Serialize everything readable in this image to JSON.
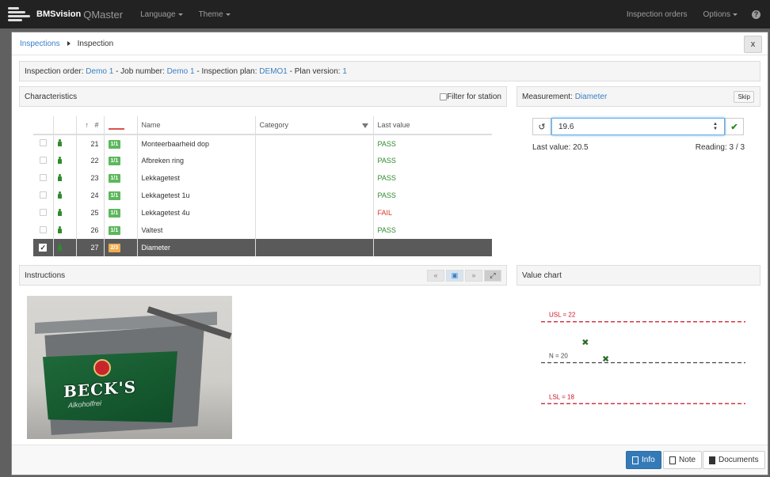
{
  "navbar": {
    "brand_name": "BMSvision",
    "brand_sub": "QMaster",
    "language": "Language",
    "theme": "Theme",
    "inspection_orders": "Inspection orders",
    "options": "Options",
    "help": "?"
  },
  "header": {
    "breadcrumb_root": "Inspections",
    "breadcrumb_current": "Inspection",
    "close": "x"
  },
  "order": {
    "order_label": "Inspection order:",
    "order_value": "Demo 1",
    "job_label": " - Job number:",
    "job_value": "Demo 1",
    "plan_label": " - Inspection plan:",
    "plan_value": "DEMO1",
    "version_label": " - Plan version:",
    "version_value": "1"
  },
  "characteristics": {
    "title": "Characteristics",
    "filter_label": "Filter for station",
    "columns": {
      "sort": "↑",
      "num": "#",
      "name": "Name",
      "category": "Category",
      "last_value": "Last value"
    },
    "rows": [
      {
        "num": "21",
        "badge": "1/1",
        "name": "Monteerbaarheid dop",
        "category": "",
        "last_value": "PASS"
      },
      {
        "num": "22",
        "badge": "1/1",
        "name": "Afbreken ring",
        "category": "",
        "last_value": "PASS"
      },
      {
        "num": "23",
        "badge": "1/1",
        "name": "Lekkagetest",
        "category": "",
        "last_value": "PASS"
      },
      {
        "num": "24",
        "badge": "1/1",
        "name": "Lekkagetest 1u",
        "category": "",
        "last_value": "PASS"
      },
      {
        "num": "25",
        "badge": "1/1",
        "name": "Lekkagetest 4u",
        "category": "",
        "last_value": "FAIL"
      },
      {
        "num": "26",
        "badge": "1/1",
        "name": "Valtest",
        "category": "",
        "last_value": "PASS"
      },
      {
        "num": "27",
        "badge": "2/3",
        "name": "Diameter",
        "category": "",
        "last_value": ""
      }
    ],
    "status_colors": {
      "pass": "#2e8b2e",
      "fail": "#d9372b",
      "badge_ok": "#5cb85c",
      "badge_partial": "#f0ad4e"
    }
  },
  "measurement": {
    "label": "Measurement:",
    "name": "Diameter",
    "skip": "Skip",
    "input_value": "19.6",
    "last_value_text": "Last value: 20.5",
    "reading_text": "Reading: 3 / 3"
  },
  "instructions": {
    "title": "Instructions",
    "image_text": "BECK'S",
    "image_subtext": "Alkoholfrei",
    "buttons": [
      "«",
      "▣",
      "»",
      "⤢"
    ]
  },
  "value_chart": {
    "title": "Value chart"
  },
  "chart_data": {
    "type": "scatter",
    "usl_label": "USL = 22",
    "nominal_label": "N = 20",
    "lsl_label": "LSL = 18",
    "usl": 22,
    "nominal": 20,
    "lsl": 18,
    "ylim": [
      17.2,
      22.8
    ],
    "xlim": [
      0,
      10
    ],
    "points": [
      {
        "x": 1,
        "y": 21.0
      },
      {
        "x": 2,
        "y": 20.2
      }
    ],
    "limit_color": "#cc1122",
    "nominal_color": "#444444",
    "point_color": "#2e6b2e"
  },
  "footer": {
    "info": "Info",
    "note": "Note",
    "documents": "Documents"
  }
}
